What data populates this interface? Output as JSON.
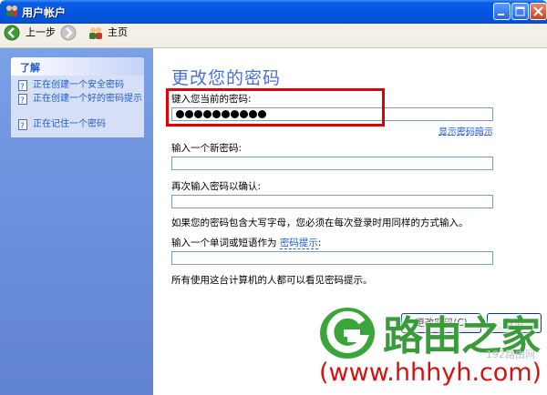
{
  "window": {
    "title": "用户帐户"
  },
  "toolbar": {
    "back_label": "上一步",
    "home_label": "主页"
  },
  "sidebar": {
    "learn_title": "了解",
    "links": [
      {
        "label": "正在创建一个安全密码"
      },
      {
        "label": "正在创建一个好的密码提示"
      },
      {
        "label": "正在记住一个密码"
      }
    ]
  },
  "main": {
    "heading": "更改您的密码",
    "current_password": {
      "label": "键入您当前的密码:",
      "value": "●●●●●●●●●●",
      "masked_length": 10
    },
    "show_hint_link": "显示密码暗示",
    "new_password": {
      "label": "输入一个新密码:",
      "value": ""
    },
    "confirm_password": {
      "label": "再次输入密码以确认:",
      "value": ""
    },
    "case_note": "如果您的密码包含大写字母，您必须在每次登录时用同样的方式输入。",
    "hint_prompt_prefix": "输入一个单词或短语作为",
    "hint_prompt_link": "密码提示",
    "hint_prompt_suffix": ":",
    "hint_value": "",
    "visibility_note": "所有使用这台计算机的人都可以看见密码提示。",
    "change_button_label": "更改密码(C)",
    "cancel_button_label": "取消"
  },
  "watermark": {
    "name": "路由之家",
    "url": "(www.hhhyh.com)",
    "small": "192路由网"
  },
  "colors": {
    "highlight": "#e00000",
    "link": "#215dc6",
    "heading": "#4b6fd6",
    "watermark_green": "#3a9b3a",
    "watermark_red": "#d91010"
  }
}
